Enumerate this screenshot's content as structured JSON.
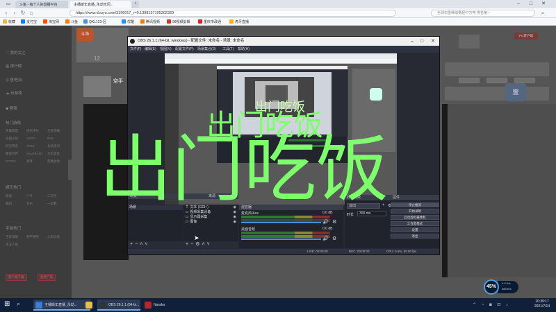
{
  "browser": {
    "tabs": [
      {
        "label": "斗鱼 - 每个人的直播平台"
      },
      {
        "label": "主播斯年直播_永劫无间..."
      }
    ],
    "url": "https://www.douyu.com/3196017_r=0.1398157105302329",
    "search_placeholder": "全球石墨稀储量超47万吨 排名第一",
    "bookmarks": [
      "收藏",
      "支付宝",
      "淘宝网",
      "斗鱼",
      "QKL123-区",
      "优酷",
      "腾讯视频",
      "99视频剪辑",
      "重庆市政通",
      "虎牙直播"
    ]
  },
  "left_nav": {
    "items": [
      "我的关注",
      "排行榜",
      "鱼吧(4)",
      "云游戏",
      "赛事"
    ],
    "section1_title": "热门游戏",
    "section1_games": [
      "英雄联盟",
      "绝地求生",
      "王者荣耀",
      "穿越火线",
      "CSGO",
      "DNF",
      "炉石传说",
      "APEX",
      "永劫无间",
      "魔兽世界",
      "VALORANT",
      "主机游戏",
      "DOTA2",
      "原神",
      "刺激战场",
      "APEX英雄"
    ],
    "section2_title": "娱乐热门",
    "section2_items": [
      "颜值",
      "户外",
      "二次元",
      "舞蹈",
      "音乐",
      "一起看"
    ],
    "section3_title": "手游热门",
    "section3_items": [
      "王者荣耀",
      "和平精英",
      "火影忍者",
      "第五人格"
    ],
    "buttons": [
      "客户端下载",
      "鱼吧广场"
    ]
  },
  "obs": {
    "title": "OBS 26.1.1 (64-bit, windows) - 配置文件: 未命名 - 场景: 未命名",
    "menu": [
      "文件(F)",
      "编辑(E)",
      "视图(V)",
      "配置文件(P)",
      "场景集合(S)",
      "工具(T)",
      "帮助(H)"
    ],
    "docks": {
      "scenes": "场景",
      "sources": "来源",
      "mixer": "混音器",
      "transitions": "转场特效",
      "controls": "控件"
    },
    "scene_items": [
      "场景"
    ],
    "source_items": [
      {
        "icon": "T",
        "label": "文本 (GDI+)"
      },
      {
        "icon": "▭",
        "label": "视频采集设备"
      },
      {
        "icon": "▭",
        "label": "显示器采集"
      },
      {
        "icon": "▭",
        "label": "图像"
      }
    ],
    "mixer_tracks": [
      {
        "name": "麦克风/Aux",
        "db": "0.0 dB"
      },
      {
        "name": "桌面音频",
        "db": "0.0 dB"
      }
    ],
    "transition_type": "淡出",
    "duration_label": "时长",
    "duration_value": "300 ms",
    "control_buttons": [
      "停止推流",
      "开始录制",
      "启动虚拟摄像机",
      "工作室模式",
      "设置",
      "退出"
    ],
    "status": {
      "live": "LIVE: 00:00:00",
      "rec": "REC: 00:00:00",
      "cpu": "CPU: 0.6%, 60.00 fps"
    }
  },
  "page": {
    "room_number": "12",
    "sub_label": "空手"
  },
  "overlay_text": {
    "small": "出门吃饭",
    "medium": "出门吃饭",
    "large": "出门吃饭"
  },
  "taskbar": {
    "items": [
      "主播斯年直播_永劫...",
      "OBS 26.1.1 (64-bi...",
      "Naraka"
    ],
    "time": "10:39:17",
    "date": "2021/7/14"
  },
  "speed_widget": {
    "percent": "45%",
    "upload": "4.2 K/s",
    "download": "365 K/s"
  },
  "colors": {
    "overlay_green": "#7cff6b",
    "obs_bg": "#272a33",
    "taskbar": "#11203a"
  }
}
